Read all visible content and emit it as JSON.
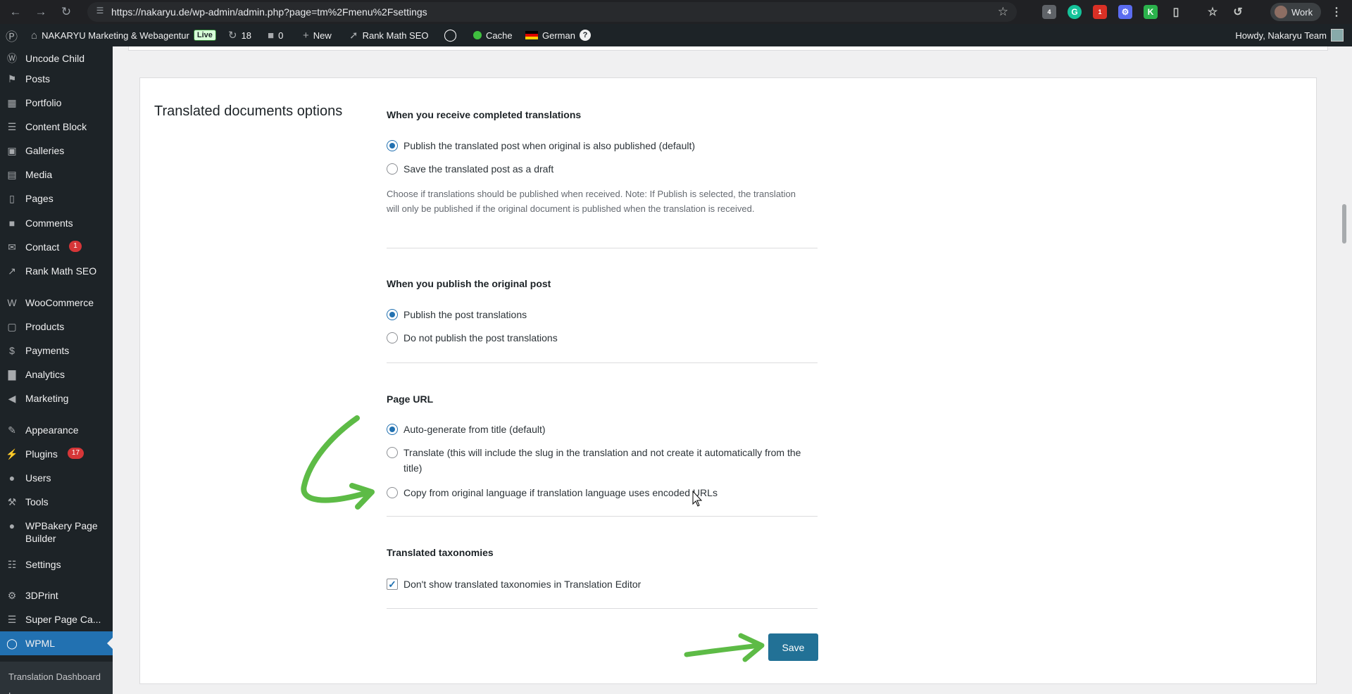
{
  "browser": {
    "url": "https://nakaryu.de/wp-admin/admin.php?page=tm%2Fmenu%2Fsettings",
    "profile": "Work",
    "ext_badges": [
      "4",
      "1"
    ]
  },
  "adminbar": {
    "site_name": "NAKARYU Marketing & Webagentur",
    "live": "Live",
    "updates": "18",
    "comments": "0",
    "new": "New",
    "rank_math": "Rank Math SEO",
    "cache": "Cache",
    "language": "German",
    "help": "?",
    "howdy": "Howdy, Nakaryu Team"
  },
  "sidebar": {
    "items": [
      {
        "label": "Uncode Child",
        "icon": "wordpress-icon"
      },
      {
        "label": "Posts",
        "icon": "pin-icon"
      },
      {
        "label": "Portfolio",
        "icon": "grid-icon"
      },
      {
        "label": "Content Block",
        "icon": "list-icon"
      },
      {
        "label": "Galleries",
        "icon": "gallery-icon"
      },
      {
        "label": "Media",
        "icon": "media-icon"
      },
      {
        "label": "Pages",
        "icon": "pages-icon"
      },
      {
        "label": "Comments",
        "icon": "comment-icon"
      },
      {
        "label": "Contact",
        "icon": "mail-icon",
        "badge": "1"
      },
      {
        "label": "Rank Math SEO",
        "icon": "chart-icon"
      },
      {
        "label": "WooCommerce",
        "icon": "woo-icon"
      },
      {
        "label": "Products",
        "icon": "box-icon"
      },
      {
        "label": "Payments",
        "icon": "dollar-icon"
      },
      {
        "label": "Analytics",
        "icon": "analytics-icon"
      },
      {
        "label": "Marketing",
        "icon": "megaphone-icon"
      },
      {
        "label": "Appearance",
        "icon": "brush-icon"
      },
      {
        "label": "Plugins",
        "icon": "plug-icon",
        "badge": "17"
      },
      {
        "label": "Users",
        "icon": "user-icon"
      },
      {
        "label": "Tools",
        "icon": "wrench-icon"
      },
      {
        "label": "WPBakery Page Builder",
        "icon": "bakery-icon"
      },
      {
        "label": "Settings",
        "icon": "settings-icon"
      },
      {
        "label": "3DPrint",
        "icon": "gear-icon"
      },
      {
        "label": "Super Page Ca...",
        "icon": "document-icon"
      },
      {
        "label": "WPML",
        "icon": "wpml-icon",
        "active": true
      }
    ],
    "submenu": [
      "Translation Dashboard",
      "Languages"
    ]
  },
  "section": {
    "title": "Translated documents options",
    "groups": {
      "completed": {
        "title": "When you receive completed translations",
        "options": [
          "Publish the translated post when original is also published (default)",
          "Save the translated post as a draft"
        ],
        "selected": 0,
        "description": "Choose if translations should be published when received. Note: If Publish is selected, the translation will only be published if the original document is published when the translation is received."
      },
      "publish": {
        "title": "When you publish the original post",
        "options": [
          "Publish the post translations",
          "Do not publish the post translations"
        ],
        "selected": 0
      },
      "url": {
        "title": "Page URL",
        "options": [
          "Auto-generate from title (default)",
          "Translate (this will include the slug in the translation and not create it automatically from the title)",
          "Copy from original language if translation language uses encoded URLs"
        ],
        "selected": 0
      },
      "taxonomies": {
        "title": "Translated taxonomies",
        "checkbox": "Don't show translated taxonomies in Translation Editor",
        "checked": true
      }
    },
    "save": "Save"
  },
  "colors": {
    "accent": "#2271b1",
    "annotation_arrow": "#5dbb46",
    "save_button": "#227196"
  }
}
